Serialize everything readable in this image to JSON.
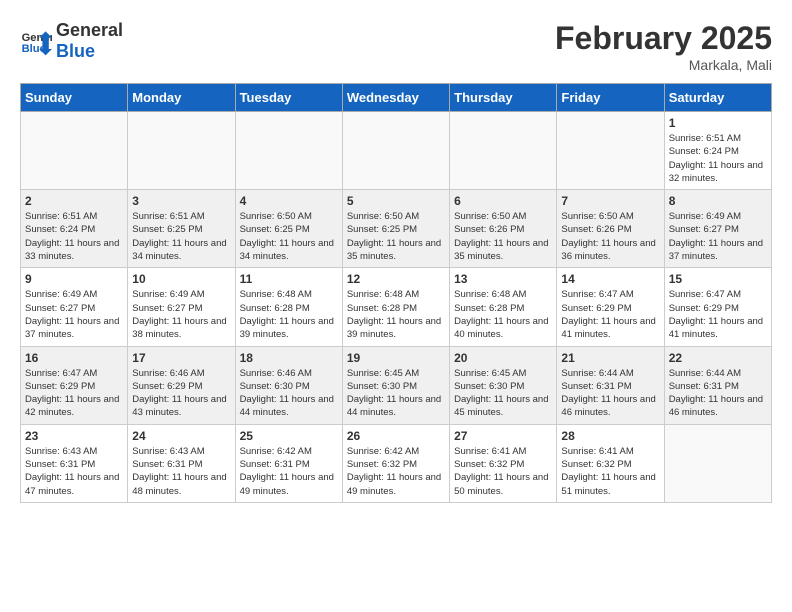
{
  "header": {
    "logo_general": "General",
    "logo_blue": "Blue",
    "title": "February 2025",
    "subtitle": "Markala, Mali"
  },
  "weekdays": [
    "Sunday",
    "Monday",
    "Tuesday",
    "Wednesday",
    "Thursday",
    "Friday",
    "Saturday"
  ],
  "weeks": [
    [
      {
        "day": "",
        "info": ""
      },
      {
        "day": "",
        "info": ""
      },
      {
        "day": "",
        "info": ""
      },
      {
        "day": "",
        "info": ""
      },
      {
        "day": "",
        "info": ""
      },
      {
        "day": "",
        "info": ""
      },
      {
        "day": "1",
        "info": "Sunrise: 6:51 AM\nSunset: 6:24 PM\nDaylight: 11 hours and 32 minutes."
      }
    ],
    [
      {
        "day": "2",
        "info": "Sunrise: 6:51 AM\nSunset: 6:24 PM\nDaylight: 11 hours and 33 minutes."
      },
      {
        "day": "3",
        "info": "Sunrise: 6:51 AM\nSunset: 6:25 PM\nDaylight: 11 hours and 34 minutes."
      },
      {
        "day": "4",
        "info": "Sunrise: 6:50 AM\nSunset: 6:25 PM\nDaylight: 11 hours and 34 minutes."
      },
      {
        "day": "5",
        "info": "Sunrise: 6:50 AM\nSunset: 6:25 PM\nDaylight: 11 hours and 35 minutes."
      },
      {
        "day": "6",
        "info": "Sunrise: 6:50 AM\nSunset: 6:26 PM\nDaylight: 11 hours and 35 minutes."
      },
      {
        "day": "7",
        "info": "Sunrise: 6:50 AM\nSunset: 6:26 PM\nDaylight: 11 hours and 36 minutes."
      },
      {
        "day": "8",
        "info": "Sunrise: 6:49 AM\nSunset: 6:27 PM\nDaylight: 11 hours and 37 minutes."
      }
    ],
    [
      {
        "day": "9",
        "info": "Sunrise: 6:49 AM\nSunset: 6:27 PM\nDaylight: 11 hours and 37 minutes."
      },
      {
        "day": "10",
        "info": "Sunrise: 6:49 AM\nSunset: 6:27 PM\nDaylight: 11 hours and 38 minutes."
      },
      {
        "day": "11",
        "info": "Sunrise: 6:48 AM\nSunset: 6:28 PM\nDaylight: 11 hours and 39 minutes."
      },
      {
        "day": "12",
        "info": "Sunrise: 6:48 AM\nSunset: 6:28 PM\nDaylight: 11 hours and 39 minutes."
      },
      {
        "day": "13",
        "info": "Sunrise: 6:48 AM\nSunset: 6:28 PM\nDaylight: 11 hours and 40 minutes."
      },
      {
        "day": "14",
        "info": "Sunrise: 6:47 AM\nSunset: 6:29 PM\nDaylight: 11 hours and 41 minutes."
      },
      {
        "day": "15",
        "info": "Sunrise: 6:47 AM\nSunset: 6:29 PM\nDaylight: 11 hours and 41 minutes."
      }
    ],
    [
      {
        "day": "16",
        "info": "Sunrise: 6:47 AM\nSunset: 6:29 PM\nDaylight: 11 hours and 42 minutes."
      },
      {
        "day": "17",
        "info": "Sunrise: 6:46 AM\nSunset: 6:29 PM\nDaylight: 11 hours and 43 minutes."
      },
      {
        "day": "18",
        "info": "Sunrise: 6:46 AM\nSunset: 6:30 PM\nDaylight: 11 hours and 44 minutes."
      },
      {
        "day": "19",
        "info": "Sunrise: 6:45 AM\nSunset: 6:30 PM\nDaylight: 11 hours and 44 minutes."
      },
      {
        "day": "20",
        "info": "Sunrise: 6:45 AM\nSunset: 6:30 PM\nDaylight: 11 hours and 45 minutes."
      },
      {
        "day": "21",
        "info": "Sunrise: 6:44 AM\nSunset: 6:31 PM\nDaylight: 11 hours and 46 minutes."
      },
      {
        "day": "22",
        "info": "Sunrise: 6:44 AM\nSunset: 6:31 PM\nDaylight: 11 hours and 46 minutes."
      }
    ],
    [
      {
        "day": "23",
        "info": "Sunrise: 6:43 AM\nSunset: 6:31 PM\nDaylight: 11 hours and 47 minutes."
      },
      {
        "day": "24",
        "info": "Sunrise: 6:43 AM\nSunset: 6:31 PM\nDaylight: 11 hours and 48 minutes."
      },
      {
        "day": "25",
        "info": "Sunrise: 6:42 AM\nSunset: 6:31 PM\nDaylight: 11 hours and 49 minutes."
      },
      {
        "day": "26",
        "info": "Sunrise: 6:42 AM\nSunset: 6:32 PM\nDaylight: 11 hours and 49 minutes."
      },
      {
        "day": "27",
        "info": "Sunrise: 6:41 AM\nSunset: 6:32 PM\nDaylight: 11 hours and 50 minutes."
      },
      {
        "day": "28",
        "info": "Sunrise: 6:41 AM\nSunset: 6:32 PM\nDaylight: 11 hours and 51 minutes."
      },
      {
        "day": "",
        "info": ""
      }
    ]
  ]
}
